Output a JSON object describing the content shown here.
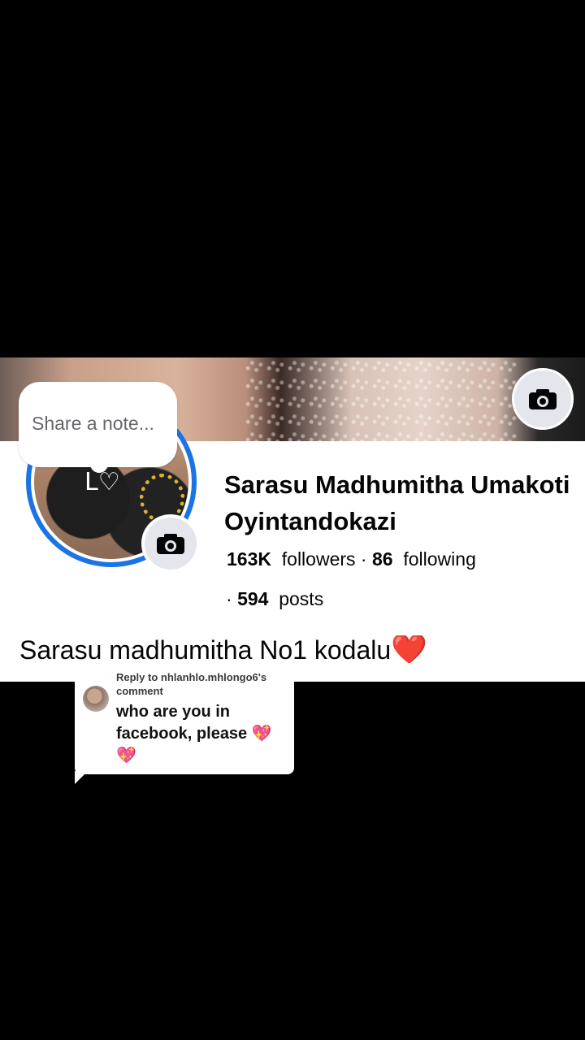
{
  "note": {
    "placeholder": "Share a note..."
  },
  "profile": {
    "name_line1": "Sarasu Madhumitha Umakoti",
    "name_line2": "Oyintandokazi",
    "followers_count": "163K",
    "followers_label": "followers",
    "separator": "·",
    "following_count": "86",
    "following_label": "following",
    "posts_count": "594",
    "posts_label": "posts",
    "bio_text": "Sarasu madhumitha No1 kodalu",
    "bio_emoji": "❤️"
  },
  "icons": {
    "cover_camera": "camera-icon",
    "avatar_camera": "camera-icon"
  },
  "reply_sticker": {
    "header": "Reply to nhlanhlo.mhlongo6's comment",
    "message": "who are you in facebook, please",
    "emoji": "💖 💖"
  },
  "colors": {
    "accent": "#1b74e4",
    "heart": "#e41e3f"
  }
}
